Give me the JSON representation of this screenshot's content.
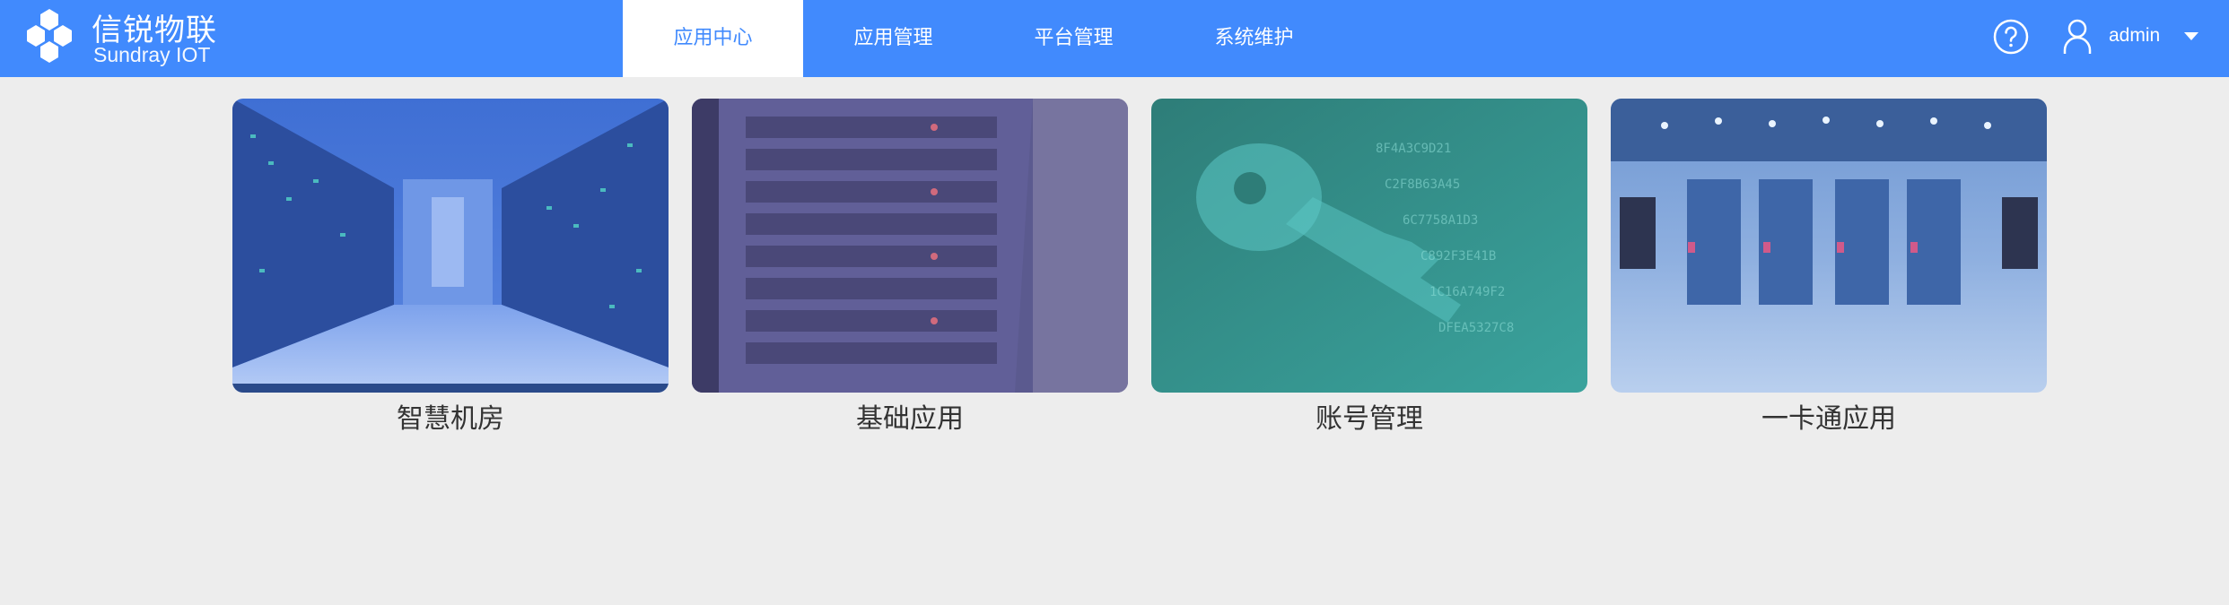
{
  "brand": {
    "name_cn": "信锐物联",
    "name_en": "Sundray IOT"
  },
  "nav": [
    {
      "label": "应用中心",
      "active": true
    },
    {
      "label": "应用管理",
      "active": false
    },
    {
      "label": "平台管理",
      "active": false
    },
    {
      "label": "系统维护",
      "active": false
    }
  ],
  "user": {
    "name": "admin"
  },
  "icons": {
    "help": "help-circle-icon",
    "user": "user-icon",
    "dropdown": "caret-down-icon"
  },
  "cards": [
    {
      "label": "智慧机房",
      "image": "data-center-aisle"
    },
    {
      "label": "基础应用",
      "image": "server-rack"
    },
    {
      "label": "账号管理",
      "image": "digital-key"
    },
    {
      "label": "一卡通应用",
      "image": "server-room"
    }
  ],
  "colors": {
    "header": "#418afd",
    "background": "#ededed",
    "text": "#333333"
  }
}
